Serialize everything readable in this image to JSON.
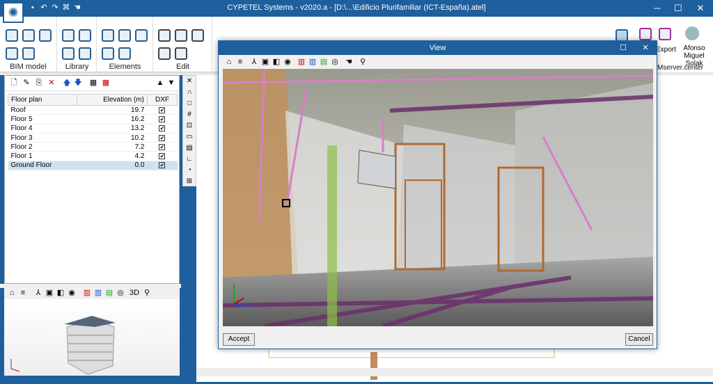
{
  "window": {
    "title": "CYPETEL Systems - v2020.a - [D:\\...\\Edificio Plurifamiliar (ICT-España).atel]",
    "min": "─",
    "max": "☐",
    "close": "✕"
  },
  "quick_access": [
    "save-icon",
    "undo-icon",
    "redo-icon",
    "binoculars-icon",
    "hand-icon"
  ],
  "ribbon": {
    "groups": [
      {
        "label": "BIM model"
      },
      {
        "label": "Library"
      },
      {
        "label": "Elements"
      },
      {
        "label": "Edit"
      }
    ],
    "export_label": "Export",
    "user_name": "Afonso\nMiguel Solak",
    "server": "Mserver.center"
  },
  "floor_table": {
    "headers": [
      "Floor plan",
      "Elevation (m)",
      "DXF"
    ],
    "rows": [
      {
        "name": "Roof",
        "elev": "19.7",
        "dxf": "✔"
      },
      {
        "name": "Floor 5",
        "elev": "16.2",
        "dxf": "✔"
      },
      {
        "name": "Floor 4",
        "elev": "13.2",
        "dxf": "✔"
      },
      {
        "name": "Floor 3",
        "elev": "10.2",
        "dxf": "✔"
      },
      {
        "name": "Floor 2",
        "elev": "7.2",
        "dxf": "✔"
      },
      {
        "name": "Floor 1",
        "elev": "4.2",
        "dxf": "✔"
      },
      {
        "name": "Ground Floor",
        "elev": "0.0",
        "dxf": "✔",
        "selected": true
      }
    ]
  },
  "dialog": {
    "title": "View",
    "accept": "Accept",
    "cancel": "Cancel"
  },
  "colors": {
    "accent": "#1e5f9e",
    "pink_pipe": "#d87fc6",
    "purple_pipe": "#6b2f6b",
    "selection": "#cfe0ef"
  }
}
